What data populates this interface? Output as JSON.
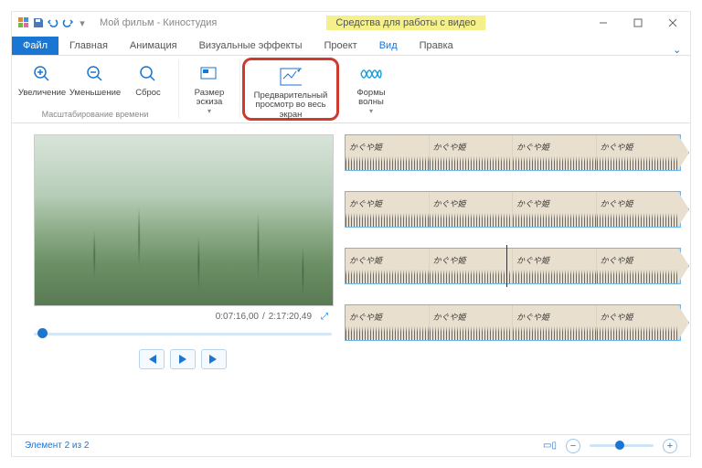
{
  "titlebar": {
    "title": "Мой фильм - Киностудия",
    "context_tab": "Средства для работы с видео"
  },
  "tabs": {
    "file": "Файл",
    "home": "Главная",
    "animation": "Анимация",
    "visual": "Визуальные эффекты",
    "project": "Проект",
    "view": "Вид",
    "edit": "Правка"
  },
  "ribbon": {
    "zoom_in": "Увеличение",
    "zoom_out": "Уменьшение",
    "reset": "Сброс",
    "group_scale": "Масштабирование времени",
    "thumb_size": "Размер эскиза",
    "preview_fullscreen": "Предварительный просмотр во весь экран",
    "waveforms": "Формы волны"
  },
  "player": {
    "current": "0:07:16,00",
    "sep": "/",
    "total": "2:17:20,49"
  },
  "clip_label": "かぐや姫",
  "status": {
    "element": "Элемент 2 из 2"
  }
}
